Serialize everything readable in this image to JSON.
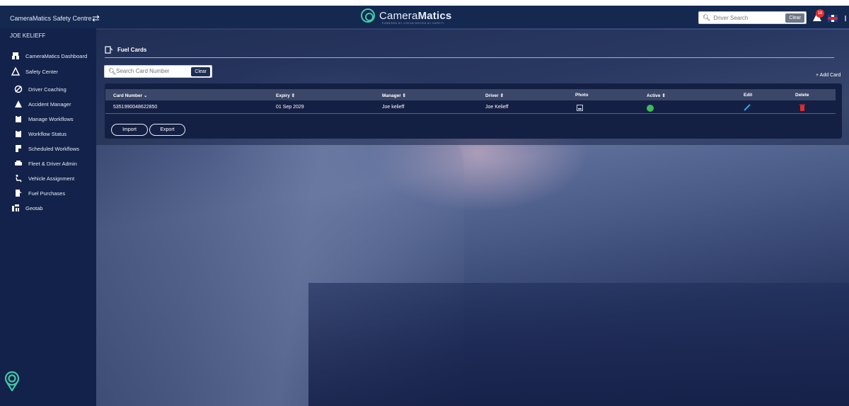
{
  "topbar": {
    "app_title": "CameraMatics Safety Centre",
    "brand_name_light": "Camera",
    "brand_name_bold": "Matics",
    "brand_tagline": "POWERED BY VISION DRIVEN BY SAFETY",
    "driver_search_placeholder": "Driver Search",
    "clear_label": "Clear",
    "alert_count": "18"
  },
  "sidebar": {
    "user": "JOE KELIEFF",
    "items": [
      {
        "label": "CameraMatics Dashboard",
        "icon": "dashboard-icon"
      },
      {
        "label": "Safety Center",
        "icon": "road-warning-icon"
      },
      {
        "label": "Driver Coaching",
        "icon": "steering-icon"
      },
      {
        "label": "Accident Manager",
        "icon": "warning-icon"
      },
      {
        "label": "Manage Workflows",
        "icon": "clipboard-icon"
      },
      {
        "label": "Workflow Status",
        "icon": "clipboard-icon"
      },
      {
        "label": "Scheduled Workflows",
        "icon": "document-icon"
      },
      {
        "label": "Fleet & Driver Admin",
        "icon": "car-icon"
      },
      {
        "label": "Vehicle Assignment",
        "icon": "driver-seat-icon"
      },
      {
        "label": "Fuel Purchases",
        "icon": "fuel-icon"
      },
      {
        "label": "Geotab",
        "icon": "geotab-icon"
      }
    ]
  },
  "panel": {
    "title": "Fuel Cards",
    "search_placeholder": "Search Card Number",
    "clear_label": "Clear",
    "add_card_label": "+ Add Card"
  },
  "table": {
    "headers": [
      "Card Number",
      "Expiry",
      "Manager",
      "Driver",
      "Photo",
      "Active",
      "Edit",
      "Delete"
    ],
    "rows": [
      {
        "card_number": "5351990048622850",
        "expiry": "01 Sep 2029",
        "manager": "Joe kelieff",
        "driver": "Joe Kelieff",
        "active": true
      }
    ]
  },
  "actions": {
    "import_label": "Import",
    "export_label": "Export"
  },
  "colors": {
    "sidebar_bg": "#13224a",
    "topbar_bg": "#142850",
    "active_green": "#3dbb5a",
    "edit_blue": "#2ea8e6",
    "delete_red": "#e02c2c",
    "brand_teal": "#3ec9a6"
  }
}
